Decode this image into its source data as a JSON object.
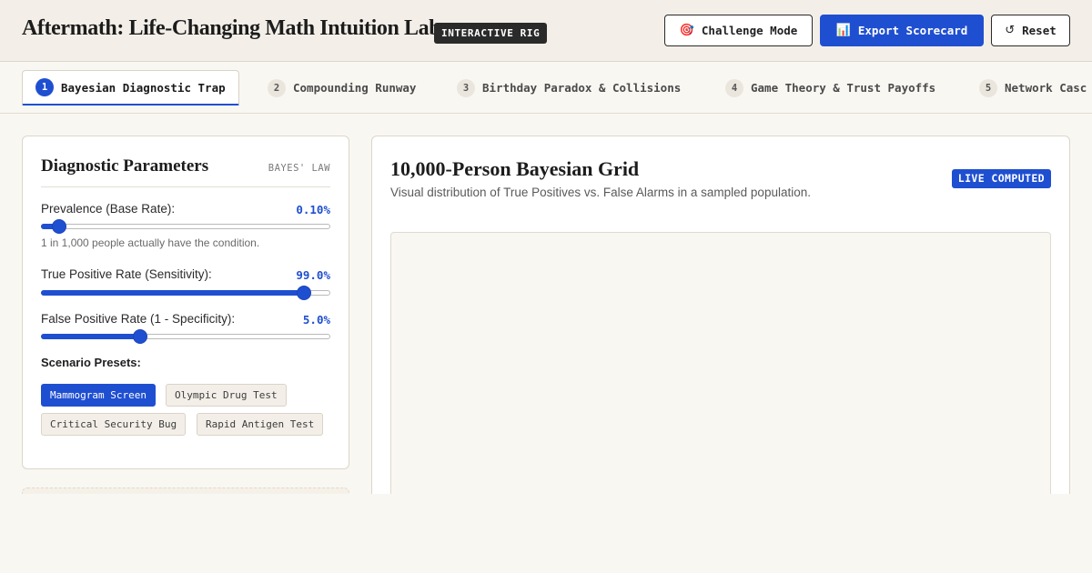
{
  "header": {
    "title": "Aftermath: Life-Changing Math Intuition Lab",
    "badge": "INTERACTIVE RIG",
    "buttons": {
      "challenge": {
        "label": "Challenge Mode",
        "icon": "target-icon",
        "glyph": "🎯"
      },
      "export": {
        "label": "Export Scorecard",
        "icon": "bar-chart-icon",
        "glyph": "📊"
      },
      "reset": {
        "label": "Reset",
        "icon": "reset-icon",
        "glyph": "↺"
      }
    }
  },
  "tabs": [
    {
      "num": "1",
      "label": "Bayesian Diagnostic Trap",
      "active": true
    },
    {
      "num": "2",
      "label": "Compounding Runway",
      "active": false
    },
    {
      "num": "3",
      "label": "Birthday Paradox & Collisions",
      "active": false
    },
    {
      "num": "4",
      "label": "Game Theory & Trust Payoffs",
      "active": false
    },
    {
      "num": "5",
      "label": "Network Casc",
      "active": false
    }
  ],
  "params_panel": {
    "title": "Diagnostic Parameters",
    "tag": "BAYES' LAW",
    "prevalence": {
      "label": "Prevalence (Base Rate):",
      "value": "0.10%",
      "note": "1 in 1,000 people actually have the condition.",
      "slider_fraction": 0.04
    },
    "sensitivity": {
      "label": "True Positive Rate (Sensitivity):",
      "value": "99.0%",
      "slider_fraction": 0.93
    },
    "false_positive": {
      "label": "False Positive Rate (1 - Specificity):",
      "value": "5.0%",
      "slider_fraction": 0.335
    },
    "presets_label": "Scenario Presets:",
    "presets": [
      {
        "label": "Mammogram Screen",
        "active": true
      },
      {
        "label": "Olympic Drug Test",
        "active": false
      },
      {
        "label": "Critical Security Bug",
        "active": false
      },
      {
        "label": "Rapid Antigen Test",
        "active": false
      }
    ]
  },
  "grid_panel": {
    "title": "10,000-Person Bayesian Grid",
    "subtitle": "Visual distribution of True Positives vs. False Alarms in a sampled population.",
    "badge": "LIVE COMPUTED"
  },
  "colors": {
    "accent": "#1f4fd1",
    "background": "#f9f7f2",
    "header": "#f3efe8"
  }
}
